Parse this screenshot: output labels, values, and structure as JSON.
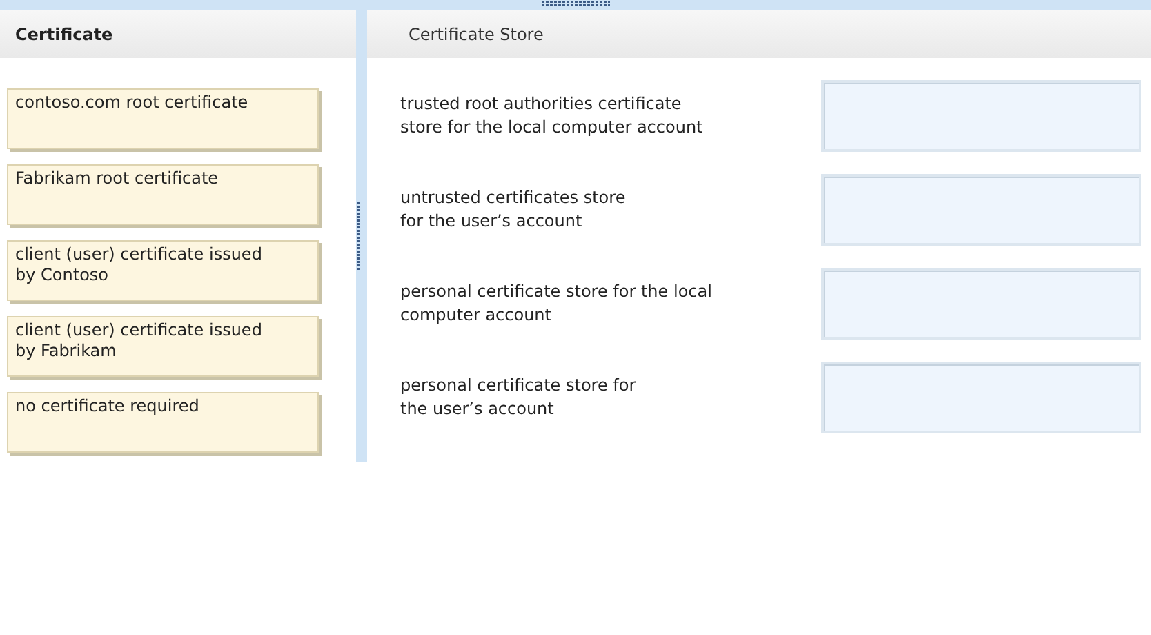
{
  "left_panel": {
    "title": "Certificate",
    "items": [
      {
        "lines": [
          "contoso.com root certificate"
        ]
      },
      {
        "lines": [
          "Fabrikam root certificate"
        ]
      },
      {
        "lines": [
          "client (user) certificate issued",
          "by Contoso"
        ]
      },
      {
        "lines": [
          "client (user) certificate issued",
          "by Fabrikam"
        ]
      },
      {
        "lines": [
          "no certificate required"
        ]
      }
    ]
  },
  "right_panel": {
    "title": "Certificate Store",
    "targets": [
      {
        "lines": [
          "trusted root authorities certificate",
          "store for the local computer account"
        ]
      },
      {
        "lines": [
          "untrusted certificates store",
          "for the user’s account"
        ]
      },
      {
        "lines": [
          "personal certificate store for the local",
          "computer account"
        ]
      },
      {
        "lines": [
          "personal certificate store for",
          "the user’s account"
        ]
      }
    ]
  }
}
